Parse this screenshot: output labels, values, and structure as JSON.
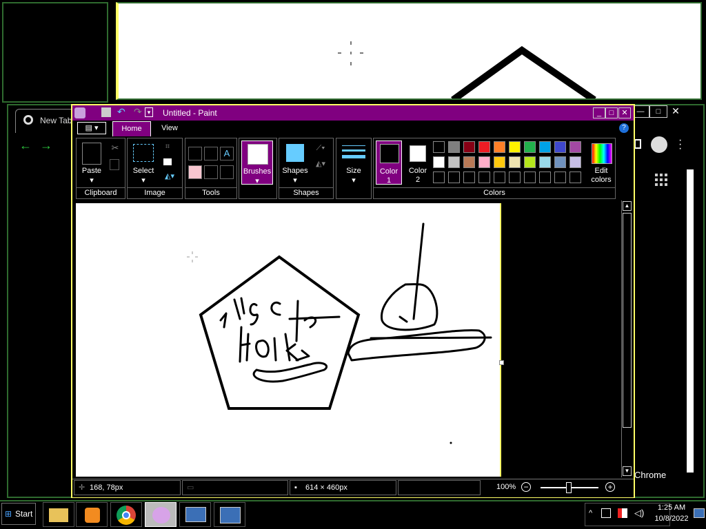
{
  "paint": {
    "title": "Untitled - Paint",
    "tabs": [
      {
        "label": "Home"
      },
      {
        "label": "View"
      }
    ],
    "groups": {
      "clipboard": {
        "label": "Clipboard",
        "paste": "Paste"
      },
      "image": {
        "label": "Image",
        "select": "Select"
      },
      "tools": {
        "label": "Tools"
      },
      "brushes": {
        "label": "Brushes"
      },
      "shapes": {
        "label": "Shapes",
        "shapes_btn": "Shapes"
      },
      "size": {
        "label": "Size"
      },
      "colors": {
        "label": "Colors",
        "color1": "Color\n1",
        "color2": "Color\n2",
        "edit": "Edit\ncolors",
        "color1_value": "#000000",
        "color2_value": "#ffffff",
        "palette_row1": [
          "#000000",
          "#7f7f7f",
          "#880015",
          "#ed1c24",
          "#ff7f27",
          "#fff200",
          "#22b14c",
          "#00a2e8",
          "#3f48cc",
          "#a349a4"
        ],
        "palette_row2": [
          "#ffffff",
          "#c3c3c3",
          "#b97a57",
          "#ffaec9",
          "#ffc90e",
          "#efe4b0",
          "#b5e61d",
          "#99d9ea",
          "#7092be",
          "#c8bfe7"
        ]
      }
    },
    "status": {
      "cursor_pos": "168, 78px",
      "selection": "",
      "canvas_size": "614 × 460px",
      "zoom": "100%"
    }
  },
  "chrome": {
    "tab_label": "New Tab",
    "side_text": "Chrome"
  },
  "taskbar": {
    "start": "Start",
    "time": "1:25 AM",
    "date": "10/8/2022"
  },
  "colors": {
    "paint_title_bg": "#800080",
    "paint_accent": "#ffff66",
    "chrome_border": "#2f6b2f"
  }
}
